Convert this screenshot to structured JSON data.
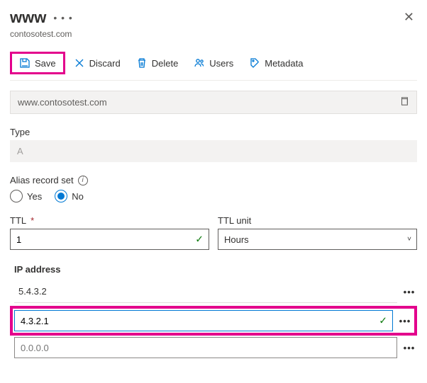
{
  "header": {
    "title": "www",
    "subtitle": "contosotest.com"
  },
  "toolbar": {
    "save_label": "Save",
    "discard_label": "Discard",
    "delete_label": "Delete",
    "users_label": "Users",
    "metadata_label": "Metadata"
  },
  "fqdn": "www.contosotest.com",
  "type": {
    "label": "Type",
    "value": "A"
  },
  "alias": {
    "label": "Alias record set",
    "yes": "Yes",
    "no": "No",
    "selected": "No"
  },
  "ttl": {
    "label": "TTL",
    "value": "1",
    "unit_label": "TTL unit",
    "unit_value": "Hours"
  },
  "ip": {
    "label": "IP address",
    "rows": [
      "5.4.3.2",
      "4.3.2.1"
    ],
    "placeholder": "0.0.0.0"
  }
}
